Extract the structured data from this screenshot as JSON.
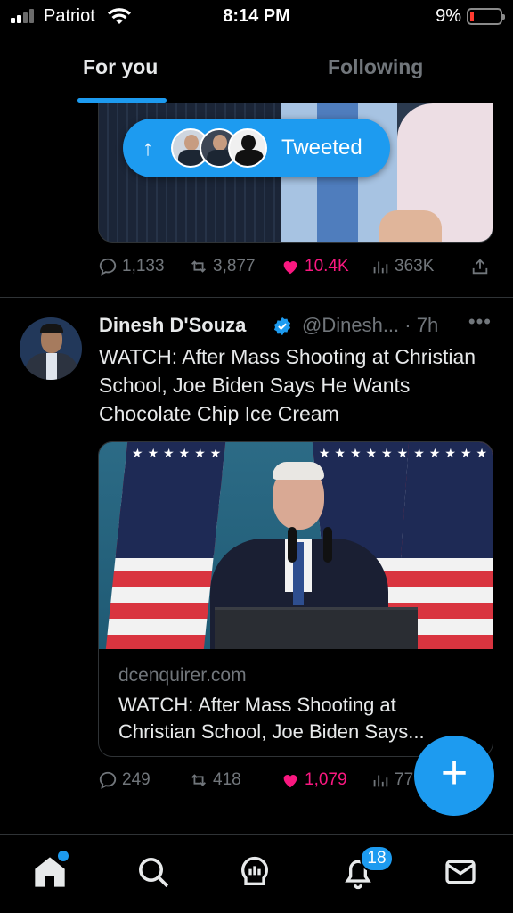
{
  "status_bar": {
    "carrier": "Patriot",
    "time": "8:14 PM",
    "battery_percent": "9%",
    "signal_bars_active": 2,
    "battery_level": 0.09,
    "battery_color": "#ff3b30"
  },
  "tabs": [
    {
      "label": "For you",
      "active": true
    },
    {
      "label": "Following",
      "active": false
    }
  ],
  "tweeted_pill": {
    "label": "Tweeted",
    "arrow": "↑"
  },
  "tweet_1": {
    "actions": {
      "replies": "1,133",
      "retweets": "3,877",
      "likes": "10.4K",
      "views": "363K"
    }
  },
  "tweet_2": {
    "author_name": "Dinesh D'Souza",
    "handle_time": "@Dinesh... · 7h",
    "more": "•••",
    "text": "WATCH: After Mass Shooting at Christian School, Joe Biden Says He Wants Chocolate Chip Ice Cream",
    "card": {
      "domain": "dcenquirer.com",
      "title": "WATCH: After Mass Shooting at\nChristian School, Joe Biden Says..."
    },
    "actions": {
      "replies": "249",
      "retweets": "418",
      "likes": "1,079",
      "views": "77"
    }
  },
  "compose_button": {
    "label": "+"
  },
  "bottom_nav": {
    "notifications_badge": "18"
  },
  "colors": {
    "accent": "#1d9bf0",
    "like": "#f91880",
    "background": "#000000",
    "muted_text": "#71767b"
  }
}
